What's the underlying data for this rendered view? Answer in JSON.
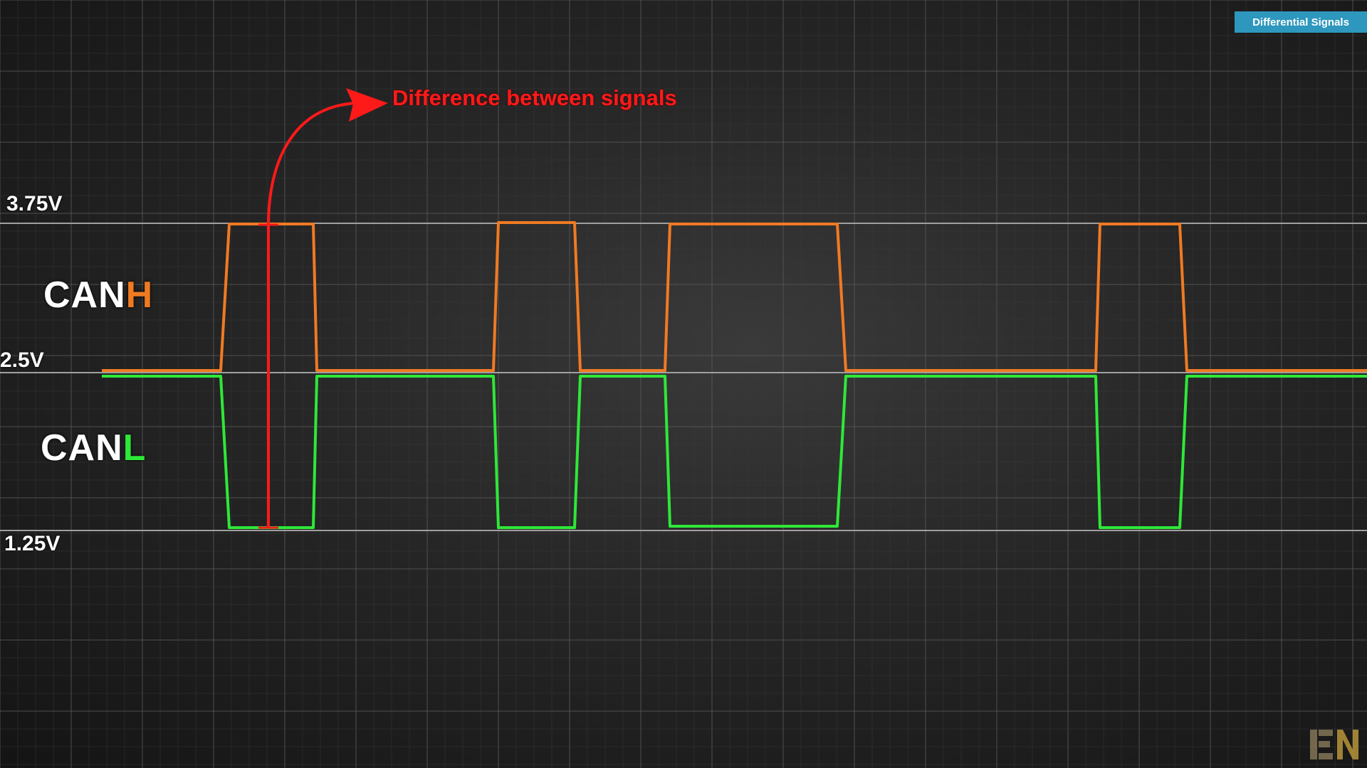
{
  "badge": {
    "text": "Differential Signals"
  },
  "levels": {
    "high": "3.75V",
    "mid": "2.5V",
    "low": "1.25V"
  },
  "signals": {
    "canh": {
      "prefix": "CAN",
      "suffix": "H"
    },
    "canl": {
      "prefix": "CAN",
      "suffix": "L"
    }
  },
  "annotation": {
    "text": "Difference between signals"
  },
  "colors": {
    "canh": "#f07a22",
    "canl": "#2ee838",
    "annotation": "#ff1a1a",
    "badge": "#2e97bd",
    "reference_lines": "#9a9a9a",
    "grid": "#555555"
  },
  "logo": {
    "icon": "channel-logo-icon"
  }
}
